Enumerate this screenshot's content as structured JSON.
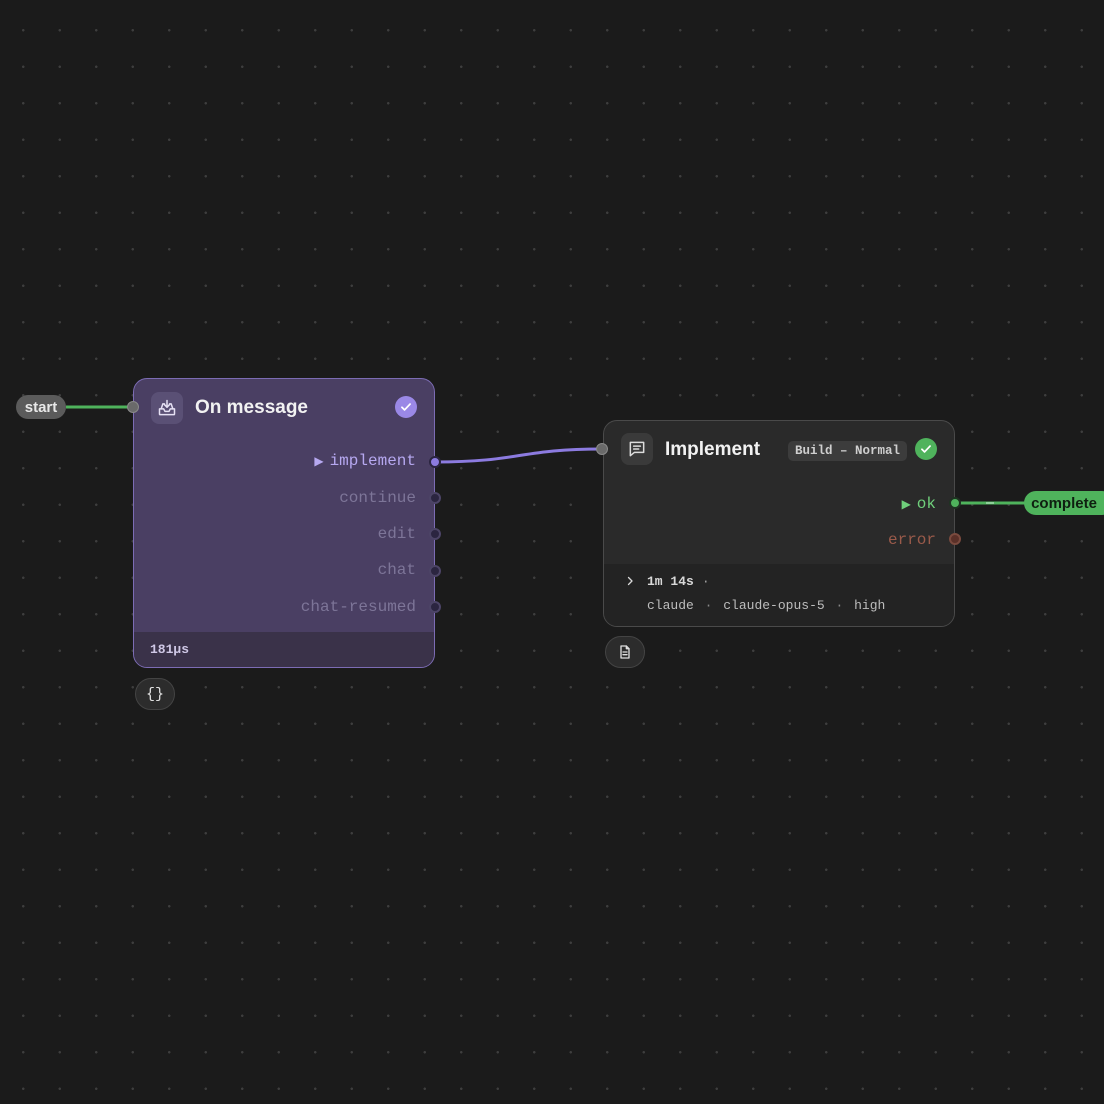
{
  "start_label": "start",
  "complete_label": "complete",
  "node_on_message": {
    "title": "On message",
    "icon": "inbox-icon",
    "status": "success",
    "outputs": [
      {
        "label": "implement",
        "active": true
      },
      {
        "label": "continue",
        "active": false
      },
      {
        "label": "edit",
        "active": false
      },
      {
        "label": "chat",
        "active": false
      },
      {
        "label": "chat-resumed",
        "active": false
      }
    ],
    "duration": "181µs",
    "action_glyph": "{}",
    "accent_color": "#8c7be0"
  },
  "node_implement": {
    "title": "Implement",
    "icon": "message-icon",
    "badge": "Build – Normal",
    "status": "success",
    "outputs": [
      {
        "label": "ok",
        "active": true
      },
      {
        "label": "error",
        "active": false
      }
    ],
    "duration": "1m 14s",
    "duration_sep": "·",
    "meta": {
      "provider": "claude",
      "model": "claude-opus-5",
      "effort": "high",
      "sep": "·"
    },
    "action_icon": "document-icon",
    "accent_color": "#4fb35c"
  }
}
